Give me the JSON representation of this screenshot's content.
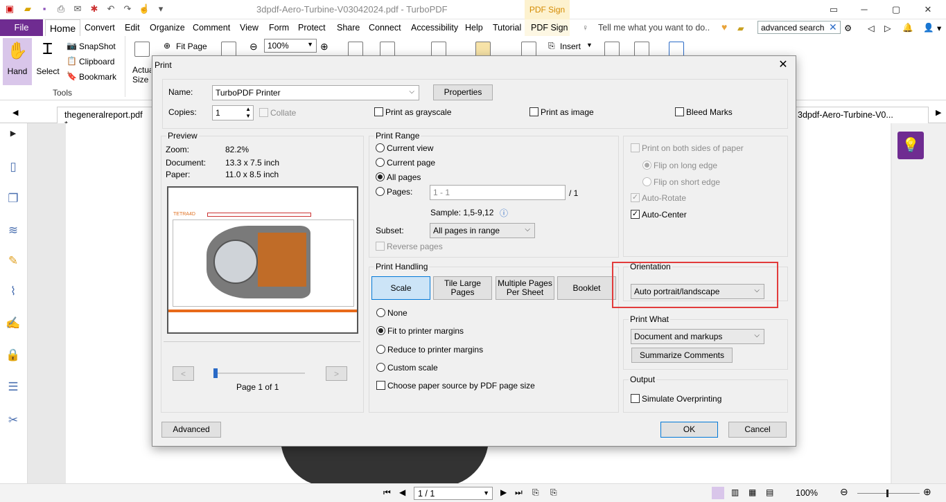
{
  "app": {
    "title": "3dpdf-Aero-Turbine-V03042024.pdf - TurboPDF",
    "pdf_sign_tab": "PDF Sign"
  },
  "menu": {
    "file": "File",
    "items": [
      "Home",
      "Convert",
      "Edit",
      "Organize",
      "Comment",
      "View",
      "Form",
      "Protect",
      "Share",
      "Connect",
      "Accessibility",
      "Help",
      "Tutorial",
      "PDF Sign"
    ],
    "tell_me": "Tell me what you want to do..",
    "search_value": "advanced search"
  },
  "ribbon": {
    "hand": "Hand",
    "select": "Select",
    "snapshot": "SnapShot",
    "clipboard": "Clipboard",
    "bookmark": "Bookmark",
    "tools_group": "Tools",
    "actual_size": "Actual Size",
    "fit_page": "Fit Page",
    "zoom": "100%",
    "insert": "Insert"
  },
  "doc_tabs": {
    "left": "thegeneralreport.pdf *",
    "right": "3dpdf-Aero-Turbine-V0..."
  },
  "status": {
    "page": "1 / 1",
    "zoom": "100%"
  },
  "dialog": {
    "title": "Print",
    "printer": {
      "name_label": "Name:",
      "name_value": "TurboPDF Printer",
      "properties": "Properties",
      "copies_label": "Copies:",
      "copies_value": "1",
      "collate": "Collate",
      "grayscale": "Print as grayscale",
      "as_image": "Print as image",
      "bleed": "Bleed Marks"
    },
    "preview": {
      "group": "Preview",
      "zoom_label": "Zoom:",
      "zoom_value": "82.2%",
      "document_label": "Document:",
      "document_value": "13.3 x 7.5 inch",
      "paper_label": "Paper:",
      "paper_value": "11.0 x 8.5 inch",
      "logo_text": "TETRA4D",
      "prev": "<",
      "next": ">",
      "page_status": "Page 1 of 1"
    },
    "range": {
      "group": "Print Range",
      "current_view": "Current view",
      "current_page": "Current page",
      "all_pages": "All pages",
      "pages": "Pages:",
      "pages_value": "1 - 1",
      "pages_total": "/ 1",
      "sample": "Sample: 1,5-9,12",
      "subset_label": "Subset:",
      "subset_value": "All pages in range",
      "reverse": "Reverse pages"
    },
    "handling": {
      "group": "Print Handling",
      "scale": "Scale",
      "tile": "Tile Large Pages",
      "multiple": "Multiple Pages Per Sheet",
      "booklet": "Booklet",
      "none": "None",
      "fit": "Fit to printer margins",
      "reduce": "Reduce to printer margins",
      "custom": "Custom scale",
      "paper_source": "Choose paper source by PDF page size"
    },
    "sides": {
      "both": "Print on both sides of paper",
      "long": "Flip on long edge",
      "short": "Flip on short edge",
      "auto_rotate": "Auto-Rotate",
      "auto_center": "Auto-Center"
    },
    "orientation": {
      "group": "Orientation",
      "value": "Auto portrait/landscape"
    },
    "print_what": {
      "group": "Print What",
      "value": "Document and markups",
      "summarize": "Summarize Comments"
    },
    "output": {
      "group": "Output",
      "simulate": "Simulate Overprinting"
    },
    "advanced": "Advanced",
    "ok": "OK",
    "cancel": "Cancel"
  },
  "colors": {
    "accent": "#6f2c91",
    "highlight": "#e23b3b",
    "selected_seg": "#cce4f7"
  }
}
